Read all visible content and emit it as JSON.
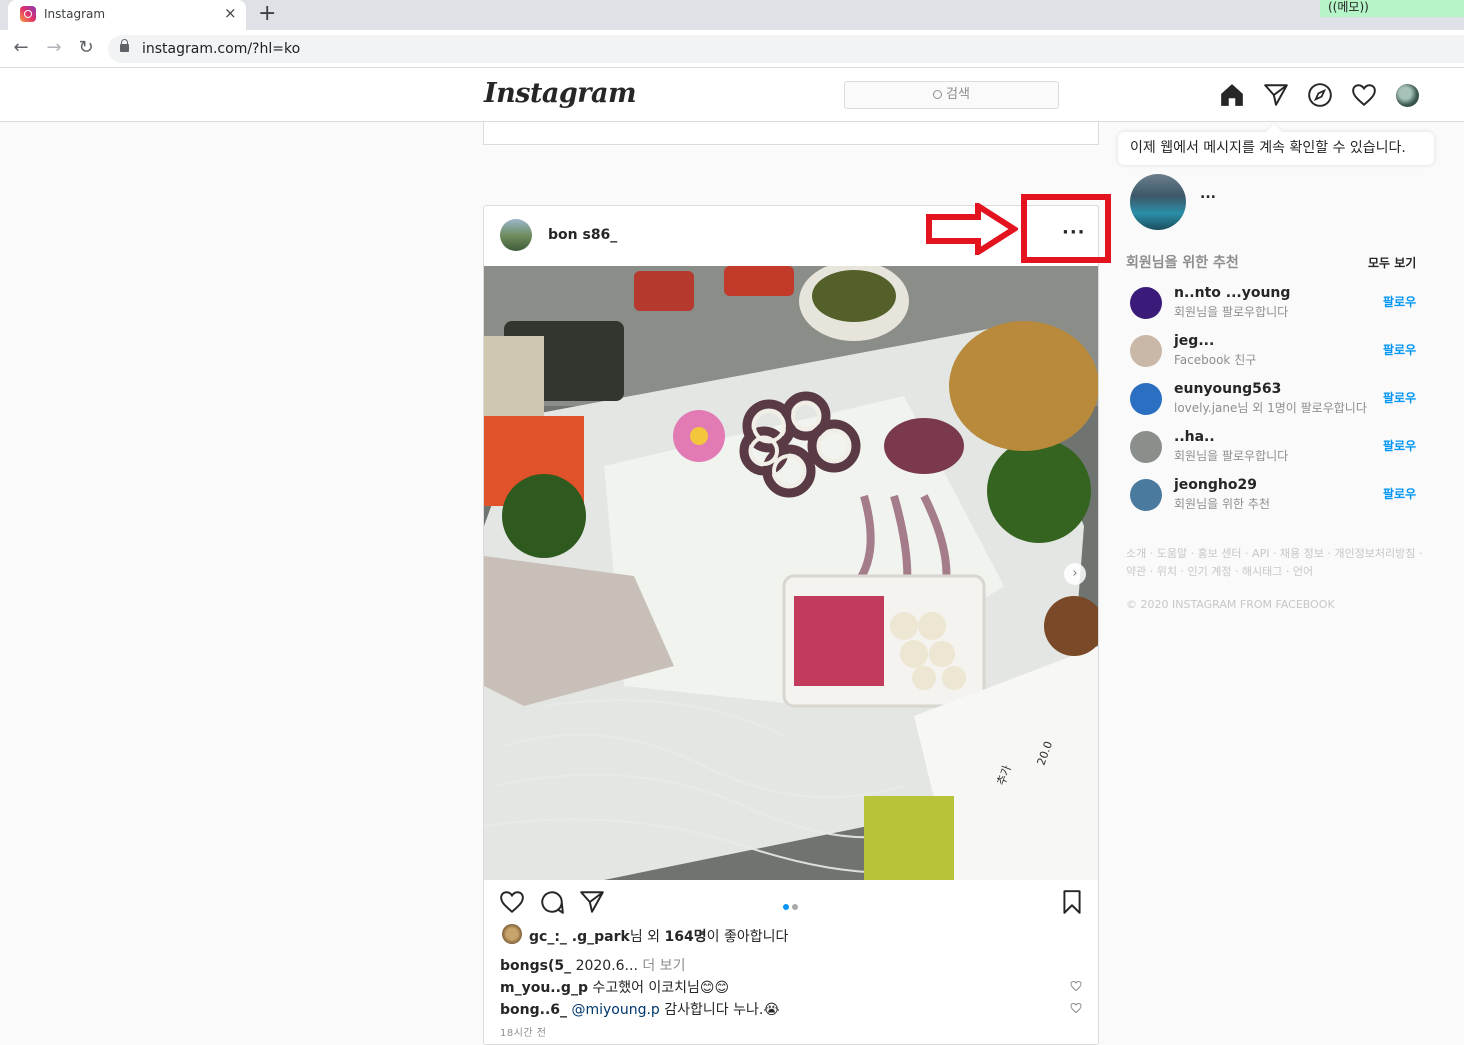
{
  "browser": {
    "tab_title": "Instagram",
    "tab_close": "×",
    "new_tab": "+",
    "memo": "((메모))",
    "url": "instagram.com/?hl=ko",
    "back": "←",
    "forward": "→",
    "reload": "↻"
  },
  "header": {
    "logo": "Instagram",
    "search_placeholder": "검색"
  },
  "post": {
    "username": "bon  s86_",
    "more": "···",
    "next_arrow": "›",
    "likes_user": "gc_:_ .g_park",
    "likes_text_1": "님 외 ",
    "likes_count": "164명",
    "likes_text_2": "이 좋아합니다",
    "caption_user": "bongs(5_",
    "caption_text": "2020.6...",
    "caption_more": " 더 보기",
    "comments": [
      {
        "user": "m_you..g_p",
        "mention": "",
        "text": " 수고했어 이코치님😊😊"
      },
      {
        "user": "bong..6_",
        "mention": "@miyoung.p",
        "text": " 감사합니다 누나.😭"
      }
    ],
    "time": "18시간 전"
  },
  "sidebar": {
    "tooltip": "이제 웹에서 메시지를 계속 확인할 수 있습니다.",
    "me_name": "...",
    "rec_title": "회원님을 위한 추천",
    "rec_all": "모두 보기",
    "suggestions": [
      {
        "name": "n..nto ...young",
        "sub": "회원님을 팔로우합니다",
        "follow": "팔로우",
        "color": "#3a1b7a"
      },
      {
        "name": "jeg...",
        "sub": "Facebook 친구",
        "follow": "팔로우",
        "color": "#c9b8a8"
      },
      {
        "name": "eunyoung563",
        "sub": "lovely.jane님 외 1명이 팔로우합니다",
        "follow": "팔로우",
        "color": "#2b6fc2"
      },
      {
        "name": "..ha..",
        "sub": "회원님을 팔로우합니다",
        "follow": "팔로우",
        "color": "#8a8f8c"
      },
      {
        "name": "jeongho29",
        "sub": "회원님을 위한 추천",
        "follow": "팔로우",
        "color": "#4a7a9e"
      }
    ],
    "footer_links": "소개 · 도움말 · 홍보 센터 · API · 채용 정보 · 개인정보처리방침 · 약관 · 위치 · 인기 계정 · 해시태그 · 언어",
    "copyright": "© 2020 INSTAGRAM FROM FACEBOOK"
  }
}
